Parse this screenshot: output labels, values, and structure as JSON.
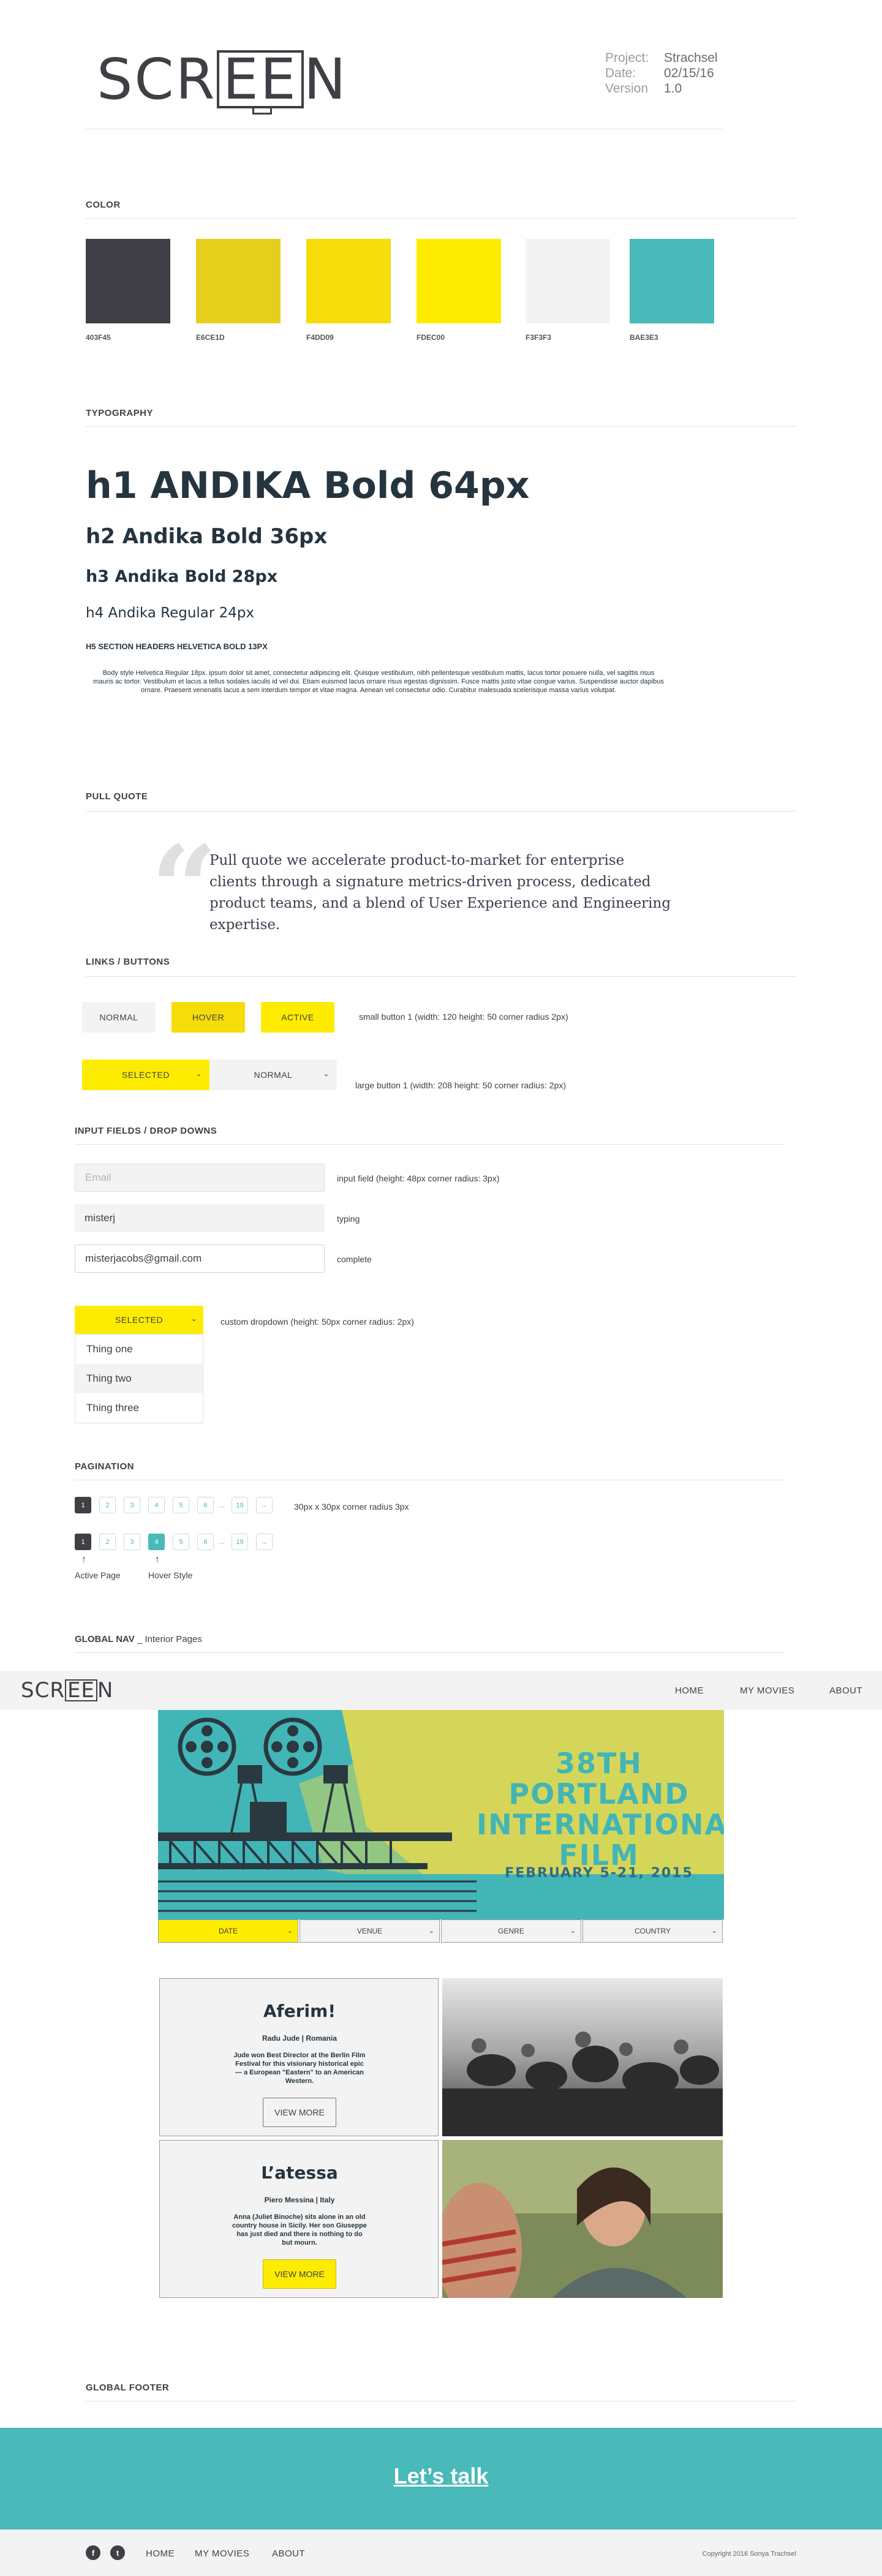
{
  "header": {
    "logo_text_left": "SCR",
    "logo_text_box": "EE",
    "logo_text_right": "N",
    "project_label": "Project:",
    "project_value": "Strachsel",
    "date_label": "Date:",
    "date_value": "02/15/16",
    "version_label": "Version",
    "version_value": "1.0"
  },
  "color_section": {
    "title": "COLOR",
    "swatches": [
      {
        "label": "403F45",
        "hex": "#403F45"
      },
      {
        "label": "E6CE1D",
        "hex": "#E6CE1D"
      },
      {
        "label": "F4DD09",
        "hex": "#F4DD09"
      },
      {
        "label": "FDEC00",
        "hex": "#FDEC00"
      },
      {
        "label": "F3F3F3",
        "hex": "#F3F3F3"
      },
      {
        "label": "BAE3E3",
        "hex": "#49B9B9"
      }
    ]
  },
  "typography": {
    "title": "TYPOGRAPHY",
    "h1": "h1 ANDIKA Bold 64px",
    "h2": "h2 Andika Bold 36px",
    "h3": "h3 Andika Bold 28px",
    "h4": "h4 Andika Regular 24px",
    "h5": "H5 SECTION HEADERS HELVETICA BOLD 13PX",
    "body": "Body style Helvetica Regular 18px. ipsum dolor sit amet, consectetur adipiscing elit. Quisque vestibulum, nibh pellentesque vestibulum mattis, lacus tortor posuere nulla, vel sagittis risus mauris ac tortor. Vestibulum et lacus a tellus sodales iaculis id vel dui. Etiam euismod lacus ornare risus egestas dignissim. Fusce mattis justo vitae congue varius. Suspendisse auctor dapibus ornare. Praesent venenatis lacus a sem interdum tempor et vitae magna. Aenean vel consectetur odio. Curabitur malesuada scelerisque massa varius volutpat."
  },
  "pull_quote": {
    "title": "PULL QUOTE",
    "mark": "“",
    "text": "Pull quote we accelerate product-to-market for enterprise clients through a signature metrics-driven process, dedicated product teams, and a blend of User Experience and Engineering expertise."
  },
  "buttons": {
    "title": "LINKS / BUTTONS",
    "normal": "NORMAL",
    "hover": "HOVER",
    "active": "ACTIVE",
    "small_note": "small button 1 (width: 120 height: 50  corner radius 2px)",
    "selected": "SELECTED",
    "normal_large": "NORMAL",
    "large_note": "large button 1 (width: 208 height: 50  corner radius: 2px)"
  },
  "inputs": {
    "title": "INPUT FIELDS / DROP DOWNS",
    "email_placeholder": "Email",
    "input_note": "input field (height: 48px corner radius: 3px)",
    "typing_value": "misterj",
    "typing_note": "typing",
    "complete_value": "misterjacobs@gmail.com",
    "complete_note": "complete",
    "dropdown_selected": "SELECTED",
    "dropdown_note": "custom dropdown (height: 50px corner radius: 2px)",
    "dropdown_items": [
      "Thing one",
      "Thing two",
      "Thing three"
    ]
  },
  "pagination": {
    "title": "PAGINATION",
    "pages": [
      "1",
      "2",
      "3",
      "4",
      "5",
      "6"
    ],
    "ellipsis": "...",
    "last": "19",
    "next": "→",
    "note": "30px  x 30px corner radius 3px",
    "active_label": "Active Page",
    "hover_label": "Hover Style"
  },
  "global_nav": {
    "title_bold": "GLOBAL NAV",
    "title_rest": " _ Interior Pages",
    "logo_left": "SCR",
    "logo_box": "EE",
    "logo_right": "N",
    "links": [
      "HOME",
      "MY MOVIES",
      "ABOUT"
    ]
  },
  "hero": {
    "title_line1": "38TH PORTLAND",
    "title_line2": "INTERNATIONAL",
    "title_line3": "FILM FESTIVAL",
    "dates": "FEBRUARY 5-21, 2015",
    "filters": [
      "DATE",
      "VENUE",
      "GENRE",
      "COUNTRY"
    ]
  },
  "movies": [
    {
      "title": "Aferim!",
      "sub": "Radu Jude | Romania",
      "desc": "Jude won Best Director at the Berlin Film Festival for this visionary historical epic — a European \"Eastern\" to an American Western.",
      "button": "VIEW MORE"
    },
    {
      "title": "L’atessa",
      "sub": "Piero Messina | Italy",
      "desc": "Anna (Juliet Binoche) sits alone in an old country house in Sicily. Her son Giuseppe has just died and there is nothing to do but mourn.",
      "button": "VIEW MORE"
    }
  ],
  "footer": {
    "title": "GLOBAL FOOTER",
    "cta": "Let’s talk",
    "facebook": "f",
    "twitter": "t",
    "links": [
      "HOME",
      "MY MOVIES",
      "ABOUT"
    ],
    "copyright": "Copyright 2016 Sonya Trachsel"
  }
}
